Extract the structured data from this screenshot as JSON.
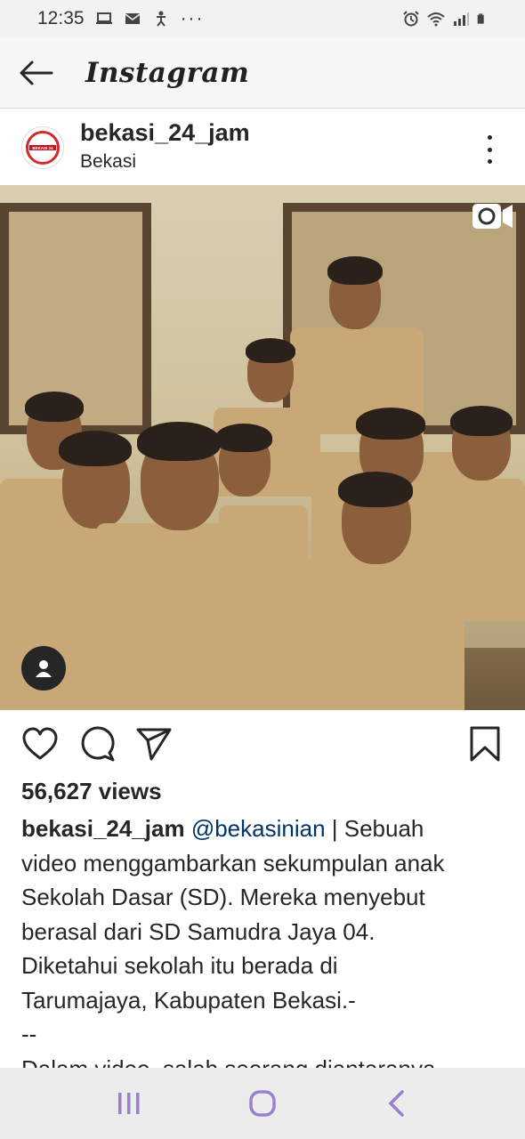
{
  "status_bar": {
    "time": "12:35",
    "dots": "···",
    "icons_left": [
      "laptop-icon",
      "mail-icon",
      "accessibility-icon"
    ],
    "icons_right": [
      "alarm-icon",
      "wifi-icon",
      "signal-icon",
      "battery-icon"
    ]
  },
  "app_bar": {
    "title": "Instagram",
    "back_icon": "arrow-left-icon"
  },
  "post": {
    "username": "bekasi_24_jam",
    "location": "Bekasi",
    "avatar_text": "BEKASI 24 JAM",
    "media_icon": "video-camera-icon",
    "tag_icon": "user-tag-icon"
  },
  "actions": {
    "like_icon": "heart-icon",
    "comment_icon": "comment-icon",
    "share_icon": "send-icon",
    "save_icon": "bookmark-icon"
  },
  "views_text": "56,627 views",
  "caption": {
    "username": "bekasi_24_jam",
    "mention": "@bekasinian",
    "line1_rest": " | Sebuah",
    "lines": [
      "video menggambarkan sekumpulan anak",
      "Sekolah Dasar (SD). Mereka menyebut",
      "berasal dari SD Samudra Jaya 04.",
      "Diketahui sekolah itu berada di",
      "Tarumajaya, Kabupaten Bekasi.-",
      "--",
      "Dalam video, salah seorang diantaranya"
    ]
  },
  "nav_bar": {
    "recent_icon": "recent-apps-icon",
    "home_icon": "home-icon",
    "back_icon": "back-chevron-icon"
  },
  "colors": {
    "accent_nav": "#9a7fd1",
    "mention": "#003569",
    "text": "#262626"
  }
}
